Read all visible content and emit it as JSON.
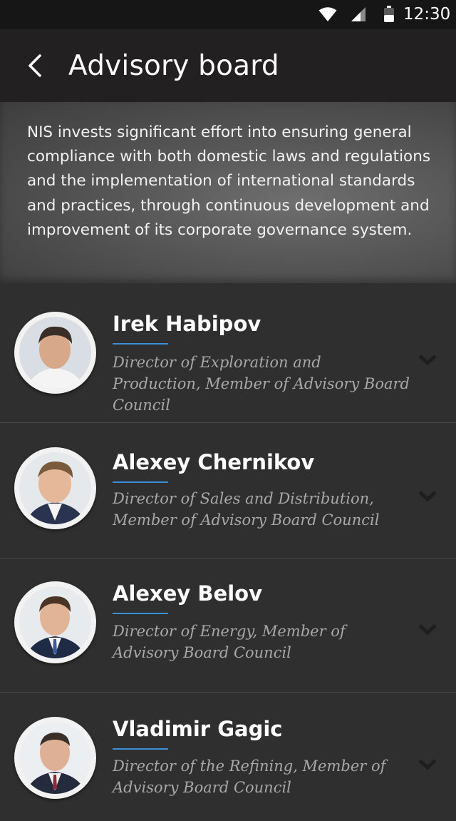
{
  "status_bar": {
    "time": "12:30",
    "icons": [
      "wifi-icon",
      "signal-icon",
      "battery-icon"
    ]
  },
  "app_bar": {
    "back_icon": "chevron-left-icon",
    "title": "Advisory board"
  },
  "intro": {
    "text": "NIS invests significant effort into ensuring general compliance with both domestic laws and regulations and the implementation of international standards and practices, through continuous development and improvement of its corporate governance system."
  },
  "people": [
    {
      "name": "Irek Habipov",
      "role": "Director of Exploration and Production, Member of Advisory Board Council"
    },
    {
      "name": "Alexey Chernikov",
      "role": "Director of Sales and Distribution, Member of Advisory Board Council"
    },
    {
      "name": "Alexey Belov",
      "role": "Director of Energy, Member of Advisory Board Council"
    },
    {
      "name": "Vladimir Gagic",
      "role": "Director of the Refining, Member of Advisory Board Council"
    }
  ],
  "colors": {
    "accent": "#3d8ed8",
    "background": "#2f2f2f",
    "app_bar": "#222020",
    "status_bar": "#161616"
  }
}
